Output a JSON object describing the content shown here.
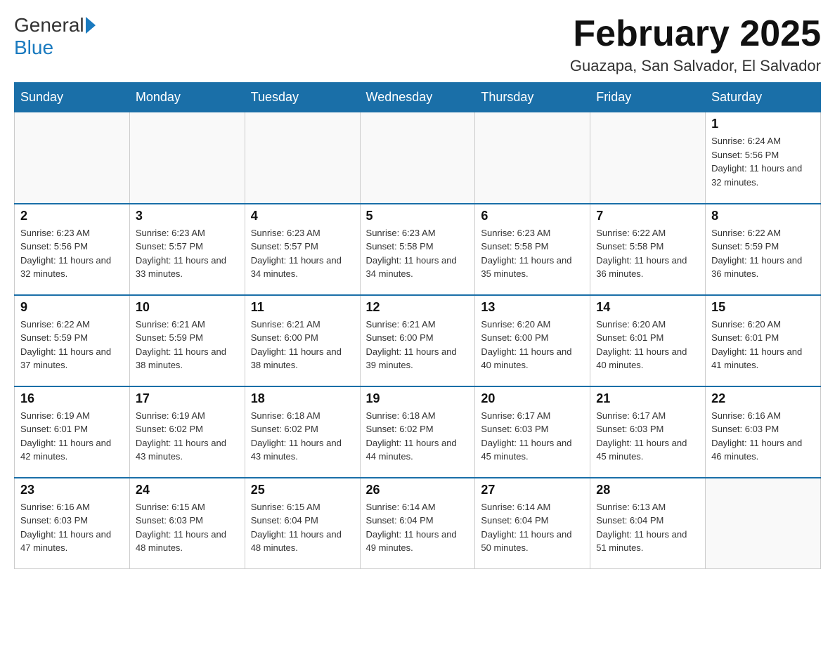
{
  "logo": {
    "general": "General",
    "blue": "Blue"
  },
  "header": {
    "title": "February 2025",
    "location": "Guazapa, San Salvador, El Salvador"
  },
  "weekdays": [
    "Sunday",
    "Monday",
    "Tuesday",
    "Wednesday",
    "Thursday",
    "Friday",
    "Saturday"
  ],
  "weeks": [
    [
      {
        "day": "",
        "sunrise": "",
        "sunset": "",
        "daylight": ""
      },
      {
        "day": "",
        "sunrise": "",
        "sunset": "",
        "daylight": ""
      },
      {
        "day": "",
        "sunrise": "",
        "sunset": "",
        "daylight": ""
      },
      {
        "day": "",
        "sunrise": "",
        "sunset": "",
        "daylight": ""
      },
      {
        "day": "",
        "sunrise": "",
        "sunset": "",
        "daylight": ""
      },
      {
        "day": "",
        "sunrise": "",
        "sunset": "",
        "daylight": ""
      },
      {
        "day": "1",
        "sunrise": "Sunrise: 6:24 AM",
        "sunset": "Sunset: 5:56 PM",
        "daylight": "Daylight: 11 hours and 32 minutes."
      }
    ],
    [
      {
        "day": "2",
        "sunrise": "Sunrise: 6:23 AM",
        "sunset": "Sunset: 5:56 PM",
        "daylight": "Daylight: 11 hours and 32 minutes."
      },
      {
        "day": "3",
        "sunrise": "Sunrise: 6:23 AM",
        "sunset": "Sunset: 5:57 PM",
        "daylight": "Daylight: 11 hours and 33 minutes."
      },
      {
        "day": "4",
        "sunrise": "Sunrise: 6:23 AM",
        "sunset": "Sunset: 5:57 PM",
        "daylight": "Daylight: 11 hours and 34 minutes."
      },
      {
        "day": "5",
        "sunrise": "Sunrise: 6:23 AM",
        "sunset": "Sunset: 5:58 PM",
        "daylight": "Daylight: 11 hours and 34 minutes."
      },
      {
        "day": "6",
        "sunrise": "Sunrise: 6:23 AM",
        "sunset": "Sunset: 5:58 PM",
        "daylight": "Daylight: 11 hours and 35 minutes."
      },
      {
        "day": "7",
        "sunrise": "Sunrise: 6:22 AM",
        "sunset": "Sunset: 5:58 PM",
        "daylight": "Daylight: 11 hours and 36 minutes."
      },
      {
        "day": "8",
        "sunrise": "Sunrise: 6:22 AM",
        "sunset": "Sunset: 5:59 PM",
        "daylight": "Daylight: 11 hours and 36 minutes."
      }
    ],
    [
      {
        "day": "9",
        "sunrise": "Sunrise: 6:22 AM",
        "sunset": "Sunset: 5:59 PM",
        "daylight": "Daylight: 11 hours and 37 minutes."
      },
      {
        "day": "10",
        "sunrise": "Sunrise: 6:21 AM",
        "sunset": "Sunset: 5:59 PM",
        "daylight": "Daylight: 11 hours and 38 minutes."
      },
      {
        "day": "11",
        "sunrise": "Sunrise: 6:21 AM",
        "sunset": "Sunset: 6:00 PM",
        "daylight": "Daylight: 11 hours and 38 minutes."
      },
      {
        "day": "12",
        "sunrise": "Sunrise: 6:21 AM",
        "sunset": "Sunset: 6:00 PM",
        "daylight": "Daylight: 11 hours and 39 minutes."
      },
      {
        "day": "13",
        "sunrise": "Sunrise: 6:20 AM",
        "sunset": "Sunset: 6:00 PM",
        "daylight": "Daylight: 11 hours and 40 minutes."
      },
      {
        "day": "14",
        "sunrise": "Sunrise: 6:20 AM",
        "sunset": "Sunset: 6:01 PM",
        "daylight": "Daylight: 11 hours and 40 minutes."
      },
      {
        "day": "15",
        "sunrise": "Sunrise: 6:20 AM",
        "sunset": "Sunset: 6:01 PM",
        "daylight": "Daylight: 11 hours and 41 minutes."
      }
    ],
    [
      {
        "day": "16",
        "sunrise": "Sunrise: 6:19 AM",
        "sunset": "Sunset: 6:01 PM",
        "daylight": "Daylight: 11 hours and 42 minutes."
      },
      {
        "day": "17",
        "sunrise": "Sunrise: 6:19 AM",
        "sunset": "Sunset: 6:02 PM",
        "daylight": "Daylight: 11 hours and 43 minutes."
      },
      {
        "day": "18",
        "sunrise": "Sunrise: 6:18 AM",
        "sunset": "Sunset: 6:02 PM",
        "daylight": "Daylight: 11 hours and 43 minutes."
      },
      {
        "day": "19",
        "sunrise": "Sunrise: 6:18 AM",
        "sunset": "Sunset: 6:02 PM",
        "daylight": "Daylight: 11 hours and 44 minutes."
      },
      {
        "day": "20",
        "sunrise": "Sunrise: 6:17 AM",
        "sunset": "Sunset: 6:03 PM",
        "daylight": "Daylight: 11 hours and 45 minutes."
      },
      {
        "day": "21",
        "sunrise": "Sunrise: 6:17 AM",
        "sunset": "Sunset: 6:03 PM",
        "daylight": "Daylight: 11 hours and 45 minutes."
      },
      {
        "day": "22",
        "sunrise": "Sunrise: 6:16 AM",
        "sunset": "Sunset: 6:03 PM",
        "daylight": "Daylight: 11 hours and 46 minutes."
      }
    ],
    [
      {
        "day": "23",
        "sunrise": "Sunrise: 6:16 AM",
        "sunset": "Sunset: 6:03 PM",
        "daylight": "Daylight: 11 hours and 47 minutes."
      },
      {
        "day": "24",
        "sunrise": "Sunrise: 6:15 AM",
        "sunset": "Sunset: 6:03 PM",
        "daylight": "Daylight: 11 hours and 48 minutes."
      },
      {
        "day": "25",
        "sunrise": "Sunrise: 6:15 AM",
        "sunset": "Sunset: 6:04 PM",
        "daylight": "Daylight: 11 hours and 48 minutes."
      },
      {
        "day": "26",
        "sunrise": "Sunrise: 6:14 AM",
        "sunset": "Sunset: 6:04 PM",
        "daylight": "Daylight: 11 hours and 49 minutes."
      },
      {
        "day": "27",
        "sunrise": "Sunrise: 6:14 AM",
        "sunset": "Sunset: 6:04 PM",
        "daylight": "Daylight: 11 hours and 50 minutes."
      },
      {
        "day": "28",
        "sunrise": "Sunrise: 6:13 AM",
        "sunset": "Sunset: 6:04 PM",
        "daylight": "Daylight: 11 hours and 51 minutes."
      },
      {
        "day": "",
        "sunrise": "",
        "sunset": "",
        "daylight": ""
      }
    ]
  ]
}
